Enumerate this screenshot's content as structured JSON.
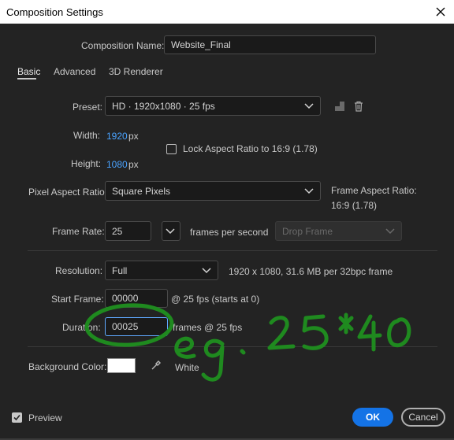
{
  "window": {
    "title": "Composition Settings"
  },
  "comp_name": {
    "label": "Composition Name:",
    "value": "Website_Final"
  },
  "tabs": [
    {
      "label": "Basic"
    },
    {
      "label": "Advanced"
    },
    {
      "label": "3D Renderer"
    }
  ],
  "preset": {
    "label": "Preset:",
    "value": "HD  ·  1920x1080 · 25 fps"
  },
  "width": {
    "label": "Width:",
    "value": "1920",
    "unit": "px"
  },
  "height": {
    "label": "Height:",
    "value": "1080",
    "unit": "px"
  },
  "lock_aspect": {
    "label": "Lock Aspect Ratio to 16:9 (1.78)",
    "checked": false
  },
  "pixel_aspect": {
    "label": "Pixel Aspect Ratio:",
    "value": "Square Pixels"
  },
  "frame_aspect": {
    "label": "Frame Aspect Ratio:",
    "value": "16:9 (1.78)"
  },
  "frame_rate": {
    "label": "Frame Rate:",
    "value": "25",
    "unit": "frames per second",
    "drop_frame": "Drop Frame"
  },
  "resolution": {
    "label": "Resolution:",
    "value": "Full",
    "info": "1920 x 1080, 31.6 MB per 32bpc frame"
  },
  "start_frame": {
    "label": "Start Frame:",
    "value": "00000",
    "info": "@ 25 fps (starts at 0)"
  },
  "duration": {
    "label": "Duration:",
    "value": "00025",
    "info": "frames @ 25 fps"
  },
  "background": {
    "label": "Background Color:",
    "color": "#ffffff",
    "name": "White"
  },
  "preview": {
    "label": "Preview",
    "checked": true
  },
  "buttons": {
    "ok": "OK",
    "cancel": "Cancel"
  },
  "annotation": {
    "text": "e.g. 25*40",
    "color": "#1f8a1f"
  },
  "colors": {
    "accent": "#1473e6",
    "link_blue": "#4aa3ff",
    "background": "#232323"
  }
}
